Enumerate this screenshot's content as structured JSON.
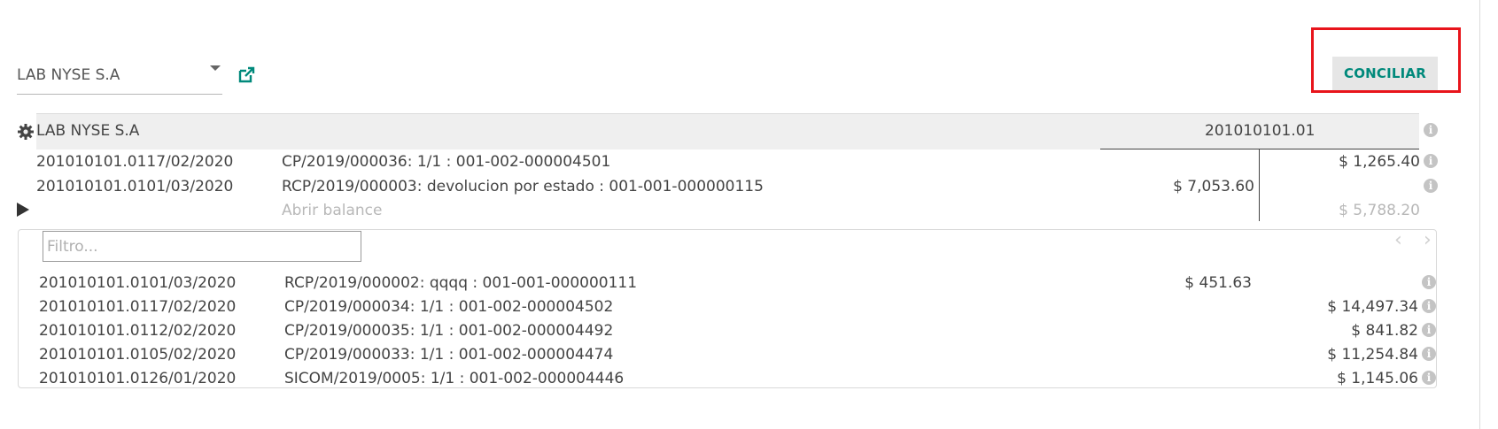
{
  "partner": {
    "name": "LAB NYSE S.A"
  },
  "toolbar": {
    "reconcile_label": "CONCILIAR"
  },
  "header": {
    "name": "LAB NYSE S.A",
    "account": "201010101.01"
  },
  "matched_lines": [
    {
      "ref_date": "201010101.0117/02/2020",
      "label": "CP/2019/000036: 1/1 : 001-002-000004501",
      "debit": "",
      "credit": "$ 1,265.40"
    },
    {
      "ref_date": "201010101.0101/03/2020",
      "label": "RCP/2019/000003: devolucion por estado : 001-001-000000115",
      "debit": "$ 7,053.60",
      "credit": ""
    }
  ],
  "open_balance": {
    "label": "Abrir balance",
    "amount": "$ 5,788.20"
  },
  "filter": {
    "placeholder": "Filtro..."
  },
  "pager": {
    "prev": "‹",
    "next": "›"
  },
  "candidate_lines": [
    {
      "ref_date": "201010101.0101/03/2020",
      "label": "RCP/2019/000002: qqqq : 001-001-000000111",
      "debit": "$ 451.63",
      "credit": ""
    },
    {
      "ref_date": "201010101.0117/02/2020",
      "label": "CP/2019/000034: 1/1 : 001-002-000004502",
      "debit": "",
      "credit": "$ 14,497.34"
    },
    {
      "ref_date": "201010101.0112/02/2020",
      "label": "CP/2019/000035: 1/1 : 001-002-000004492",
      "debit": "",
      "credit": "$ 841.82"
    },
    {
      "ref_date": "201010101.0105/02/2020",
      "label": "CP/2019/000033: 1/1 : 001-002-000004474",
      "debit": "",
      "credit": "$ 11,254.84"
    },
    {
      "ref_date": "201010101.0126/01/2020",
      "label": "SICOM/2019/0005: 1/1 : 001-002-000004446",
      "debit": "",
      "credit": "$ 1,145.06"
    }
  ],
  "icons": {
    "info": "i"
  },
  "colors": {
    "accent": "#00897b",
    "highlight": "#e8141b"
  }
}
